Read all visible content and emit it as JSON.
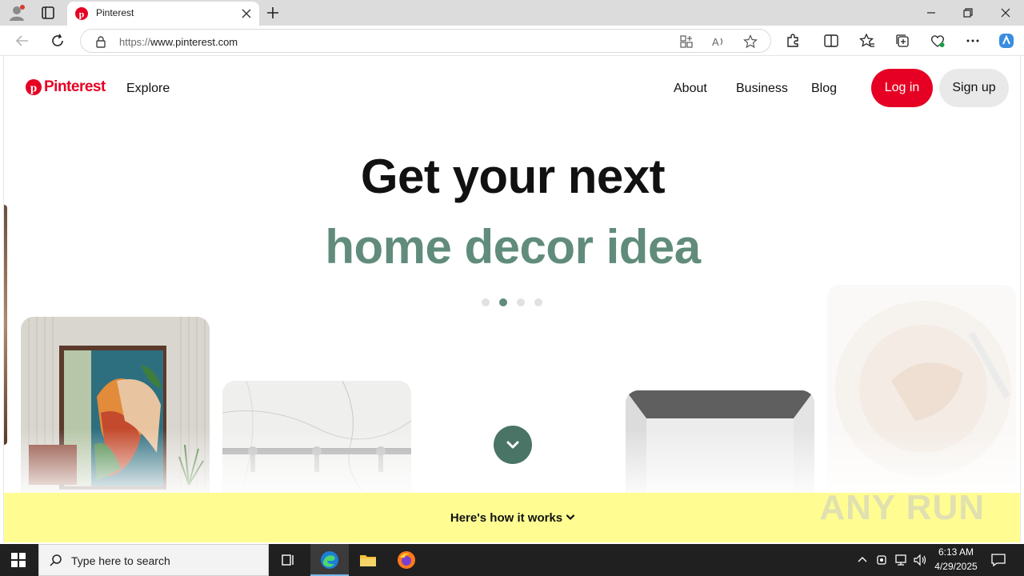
{
  "browser": {
    "tab_title": "Pinterest",
    "url_prefix": "https://",
    "url_host": "www.pinterest.com"
  },
  "header": {
    "logo_text": "Pinterest",
    "explore": "Explore",
    "about": "About",
    "business": "Business",
    "blog": "Blog",
    "login": "Log in",
    "signup": "Sign up"
  },
  "hero": {
    "headline": "Get your next",
    "subline": "home decor idea",
    "carousel_active_index": 1,
    "carousel_count": 4
  },
  "footer_bar": {
    "how_it_works": "Here's how it works"
  },
  "watermark": "ANY RUN",
  "taskbar": {
    "search_placeholder": "Type here to search",
    "time": "6:13 AM",
    "date": "4/29/2025"
  },
  "colors": {
    "brand_red": "#e60023",
    "accent_green": "#618c7b",
    "how_bar_yellow": "#fffd92"
  }
}
